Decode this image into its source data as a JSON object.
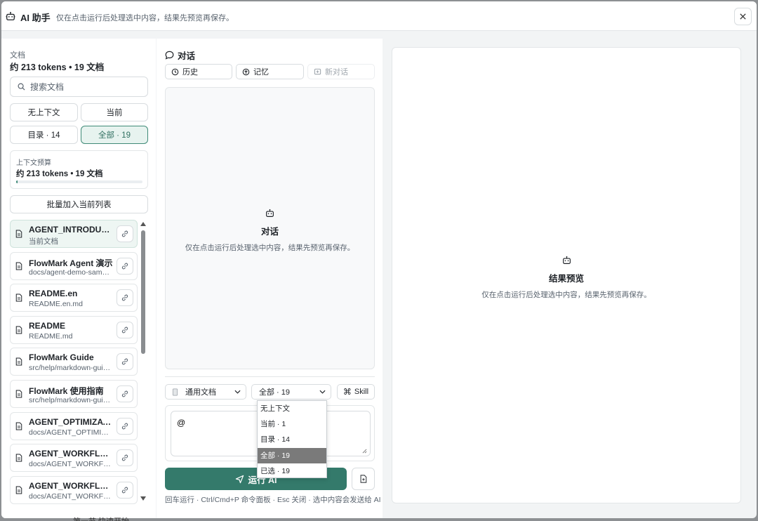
{
  "titlebar": {
    "title": "AI 助手",
    "subtitle": "仅在点击运行后处理选中内容，结果先预览再保存。",
    "close_icon": "close-icon"
  },
  "docs": {
    "label": "文档",
    "stat": "约 213 tokens • 19 文档",
    "search_placeholder": "搜索文档",
    "scopes": [
      "无上下文",
      "当前",
      "目录 · 14",
      "全部 · 19"
    ],
    "active_scope": "全部 · 19",
    "budget": {
      "label": "上下文预算",
      "value": "约 213 tokens • 19 文档",
      "progress": 0.01
    },
    "batch_label": "批量加入当前列表",
    "items": [
      {
        "title": "AGENT_INTRODUCTION",
        "sub": "当前文档",
        "current": true
      },
      {
        "title": "FlowMark Agent 演示",
        "sub": "docs/agent-demo-sample.md"
      },
      {
        "title": "README.en",
        "sub": "README.en.md"
      },
      {
        "title": "README",
        "sub": "README.md"
      },
      {
        "title": "FlowMark Guide",
        "sub": "src/help/markdown-guide.md"
      },
      {
        "title": "FlowMark 使用指南",
        "sub": "src/help/markdown-guide.md"
      },
      {
        "title": "AGENT_OPTIMIZATION",
        "sub": "docs/AGENT_OPTIMIZATION.md"
      },
      {
        "title": "AGENT_WORKFLOW",
        "sub": "docs/AGENT_WORKFLOW.md"
      },
      {
        "title": "AGENT_WORKFLOW",
        "sub": "docs/AGENT_WORKFLOW.md"
      }
    ]
  },
  "chat": {
    "title": "对话",
    "history_label": "历史",
    "memory_label": "记忆",
    "new_label": "新对话",
    "empty_title": "对话",
    "empty_sub": "仅在点击运行后处理选中内容，结果先预览再保存。",
    "template_value": "通用文档",
    "scope_value": "全部 · 19",
    "skill_label": "Skill",
    "input_value": "@",
    "run_label": "运行 AI",
    "hint": "回车运行 · Ctrl/Cmd+P 命令面板 · Esc 关闭 · 选中内容会发送给 AI",
    "dropdown_options": [
      "无上下文",
      "当前 · 1",
      "目录 · 14",
      "全部 · 19",
      "已选 · 19"
    ],
    "dropdown_highlight": 3
  },
  "preview": {
    "title": "结果预览",
    "sub": "仅在点击运行后处理选中内容，结果先预览再保存。"
  },
  "behind": {
    "text": "第一节 快速开始"
  },
  "colors": {
    "accent": "#347a6b",
    "active_bg": "#e7f3ef",
    "border": "#d8dcdf"
  }
}
